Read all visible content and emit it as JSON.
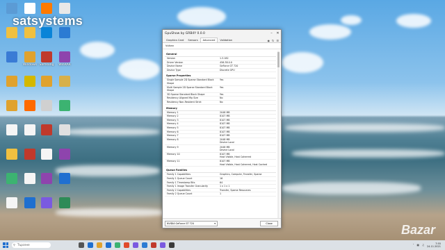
{
  "watermark": "satsystems",
  "bazar_mark": "Bazar",
  "desktop_icons": [
    {
      "label": "",
      "color": "#5b9bd5"
    },
    {
      "label": "",
      "color": "#ffffff"
    },
    {
      "label": "",
      "color": "#ff7a00"
    },
    {
      "label": "",
      "color": "#e8e8e8"
    },
    {
      "label": "",
      "color": "#f0c040"
    },
    {
      "label": "",
      "color": "#f0c040"
    },
    {
      "label": "",
      "color": "#0a84d8"
    },
    {
      "label": "",
      "color": "#2b7bd3"
    },
    {
      "label": "",
      "color": "#3a7bd5"
    },
    {
      "label": "Windows",
      "color": "#e0a22e"
    },
    {
      "label": "Samsung",
      "color": "#c0392b"
    },
    {
      "label": "WinRAR",
      "color": "#8e44ad"
    },
    {
      "label": "",
      "color": "#e0a22e"
    },
    {
      "label": "",
      "color": "#d4b800"
    },
    {
      "label": "",
      "color": "#e0a22e"
    },
    {
      "label": "",
      "color": "#d8b04a"
    },
    {
      "label": "",
      "color": "#e0a22e"
    },
    {
      "label": "",
      "color": "#ff6a00"
    },
    {
      "label": "",
      "color": "#d0d0d0"
    },
    {
      "label": "",
      "color": "#3cb371"
    },
    {
      "label": "",
      "color": "#f5f5f5"
    },
    {
      "label": "",
      "color": "#f5f5f5"
    },
    {
      "label": "",
      "color": "#c0392b"
    },
    {
      "label": "",
      "color": "#e0e0e0"
    },
    {
      "label": "",
      "color": "#f0c040"
    },
    {
      "label": "",
      "color": "#c0392b"
    },
    {
      "label": "",
      "color": "#f5f5f5"
    },
    {
      "label": "",
      "color": "#8e44ad"
    },
    {
      "label": "",
      "color": "#3cb371"
    },
    {
      "label": "",
      "color": "#f5f5f5"
    },
    {
      "label": "",
      "color": "#8e44ad"
    },
    {
      "label": "",
      "color": "#1f6fd0"
    },
    {
      "label": "",
      "color": "#f5f5f5"
    },
    {
      "label": "",
      "color": "#1f6fd0"
    },
    {
      "label": "",
      "color": "#7a5ae0"
    },
    {
      "label": "",
      "color": "#2e8b57"
    }
  ],
  "window": {
    "title": "GpuShow by GRB4Y 0.0.0",
    "tabs": [
      "Graphics Card",
      "Sensors",
      "Advanced",
      "Validation"
    ],
    "active_tab": "Advanced",
    "vulkan_label": "Vulkan",
    "sections": [
      {
        "title": "General",
        "rows": [
          {
            "k": "Version",
            "v": "1.3.182"
          },
          {
            "k": "Driver Version",
            "v": "456.38.0.0"
          },
          {
            "k": "Device Name",
            "v": "GeForce GT 720"
          },
          {
            "k": "Device Type",
            "v": "Discrete GPU"
          }
        ]
      },
      {
        "title": "Sparse Properties",
        "rows": [
          {
            "k": "Single Sample 2D Sparse Standard Block Shape",
            "v": "Yes"
          },
          {
            "k": "Multi Sample 2D Sparse Standard Block Shape",
            "v": "Yes"
          },
          {
            "k": "3D Sparse Standard Block Shape",
            "v": "Yes"
          },
          {
            "k": "Residency Aligned Mip Size",
            "v": "No"
          },
          {
            "k": "Residency Non-Resident Strict",
            "v": "No"
          }
        ]
      },
      {
        "title": "Memory",
        "rows": [
          {
            "k": "Memory 1",
            "v": "2048 MB"
          },
          {
            "k": "Memory 2",
            "v": "8107 MB"
          },
          {
            "k": "Memory 3",
            "v": "8107 MB"
          },
          {
            "k": "Memory 4",
            "v": "8107 MB"
          },
          {
            "k": "Memory 5",
            "v": "8107 MB"
          },
          {
            "k": "Memory 6",
            "v": "8107 MB"
          },
          {
            "k": "Memory 7",
            "v": "8107 MB"
          },
          {
            "k": "Memory 8",
            "v": "2048 MB\nDevice Local"
          },
          {
            "k": "Memory 9",
            "v": "2048 MB\nDevice Local"
          },
          {
            "k": "Memory 10",
            "v": "8107 MB\nHost Visible, Host Coherent"
          },
          {
            "k": "Memory 11",
            "v": "8107 MB\nHost Visible, Host Coherent, Host Cached"
          }
        ]
      },
      {
        "title": "Queue Families",
        "rows": [
          {
            "k": "Family 1 Capabilities",
            "v": "Graphics, Compute, Transfer, Sparse"
          },
          {
            "k": "Family 1 Queue Count",
            "v": "16"
          },
          {
            "k": "Family 1 Timestamp Bits",
            "v": "64"
          },
          {
            "k": "Family 1 Image Transfer Granularity",
            "v": "1 x 1 x 1"
          },
          {
            "k": "Family 2 Capabilities",
            "v": "Transfer, Sparse Resources"
          },
          {
            "k": "Family 2 Queue Count",
            "v": "1"
          }
        ]
      }
    ],
    "device_select": "NVIDIA GeForce GT 720",
    "close_label": "Close"
  },
  "taskbar": {
    "search_placeholder": "Търсене",
    "icons": [
      "#555555",
      "#1f6fd0",
      "#e0a22e",
      "#1f6fd0",
      "#3cb371",
      "#e04a2a",
      "#7a5ae0",
      "#2b7bd3",
      "#c0392b",
      "#7a5ae0",
      "#3a3a3a"
    ],
    "time": "7:55",
    "date": "24.11.2021"
  }
}
